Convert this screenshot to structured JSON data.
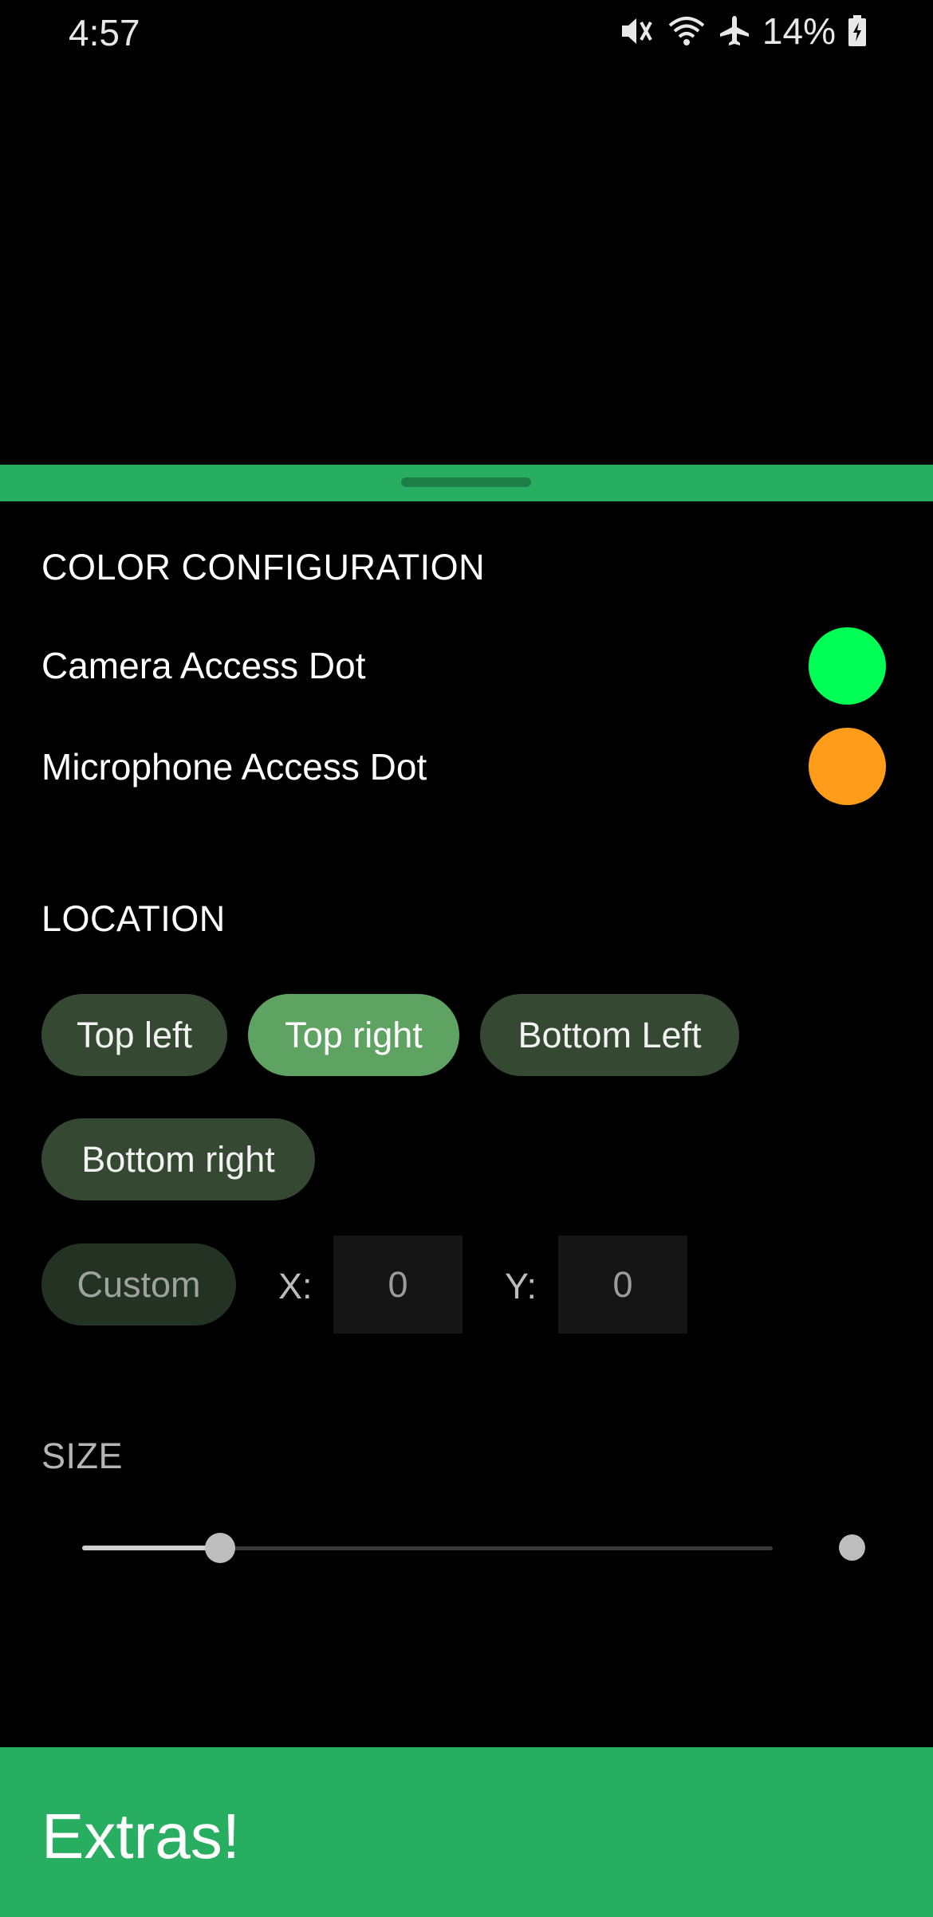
{
  "status_bar": {
    "time": "4:57",
    "battery_percent": "14%",
    "icons": [
      "vibrate-mute-icon",
      "wifi-icon",
      "airplane-icon",
      "battery-charging-icon"
    ]
  },
  "colors": {
    "accent": "#27ae60",
    "camera_dot": "#00ff55",
    "microphone_dot": "#ff9d1a",
    "chip_default": "#344832",
    "chip_selected": "#5fa362"
  },
  "color_configuration": {
    "title": "COLOR CONFIGURATION",
    "camera_label": "Camera Access Dot",
    "microphone_label": "Microphone Access Dot"
  },
  "location": {
    "title": "LOCATION",
    "options": {
      "top_left": "Top left",
      "top_right": "Top right",
      "bottom_left": "Bottom Left",
      "bottom_right": "Bottom right",
      "custom": "Custom"
    },
    "selected": "Top right",
    "x_label": "X:",
    "x_value": "0",
    "y_label": "Y:",
    "y_value": "0"
  },
  "size": {
    "title": "SIZE",
    "slider_fraction": 0.2
  },
  "footer": {
    "title": "Extras!"
  }
}
